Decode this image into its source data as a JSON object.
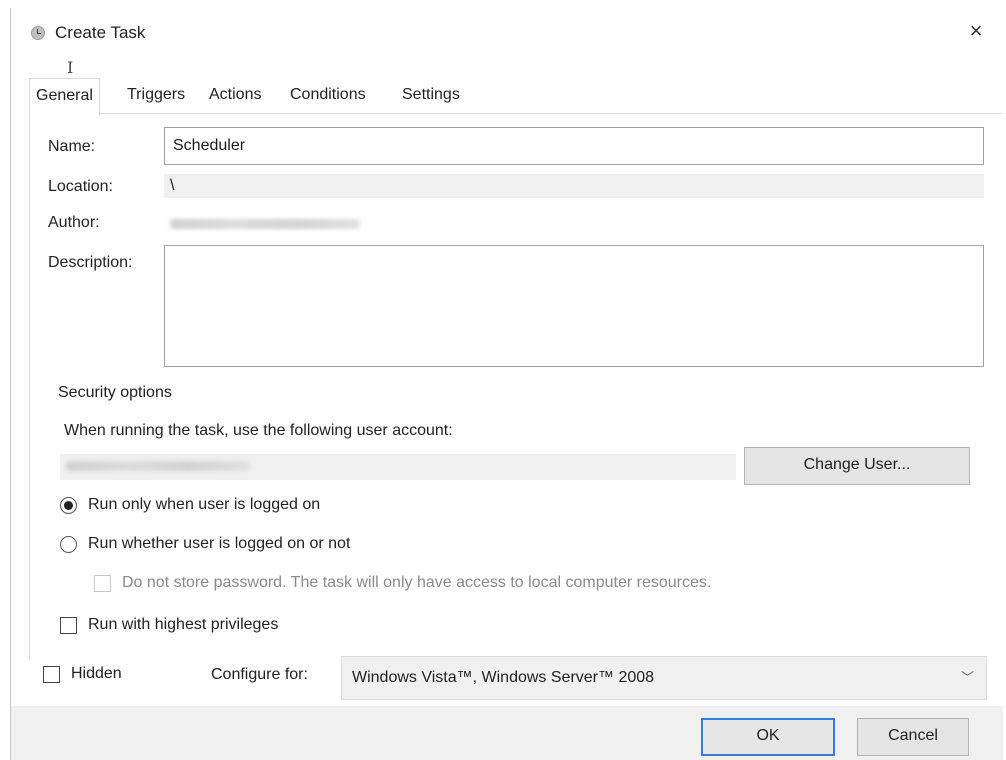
{
  "window": {
    "title": "Create Task",
    "close_symbol": "×",
    "cursor_glyph": "I"
  },
  "tabs": [
    {
      "label": "General",
      "active": true
    },
    {
      "label": "Triggers",
      "active": false
    },
    {
      "label": "Actions",
      "active": false
    },
    {
      "label": "Conditions",
      "active": false
    },
    {
      "label": "Settings",
      "active": false
    }
  ],
  "general": {
    "name_label": "Name:",
    "name_value": "Scheduler",
    "location_label": "Location:",
    "location_value": "\\",
    "author_label": "Author:",
    "description_label": "Description:",
    "description_value": ""
  },
  "security": {
    "heading": "Security options",
    "account_prompt": "When running the task, use the following user account:",
    "change_user_button": "Change User...",
    "run_logged_on": {
      "label": "Run only when user is logged on",
      "checked": true
    },
    "run_whether": {
      "label": "Run whether user is logged on or not",
      "checked": false
    },
    "do_not_store": {
      "label": "Do not store password.  The task will only have access to local computer resources.",
      "checked": false,
      "enabled": false
    },
    "highest_privileges": {
      "label": "Run with highest privileges",
      "checked": false
    }
  },
  "bottom": {
    "hidden": {
      "label": "Hidden",
      "checked": false
    },
    "configure_label": "Configure for:",
    "configure_value": "Windows Vista™, Windows Server™ 2008",
    "chevron_symbol": "﹀"
  },
  "buttons": {
    "ok": "OK",
    "cancel": "Cancel"
  },
  "colors": {
    "accent": "#3b7ad9",
    "panel_gray": "#f0f0f0"
  }
}
